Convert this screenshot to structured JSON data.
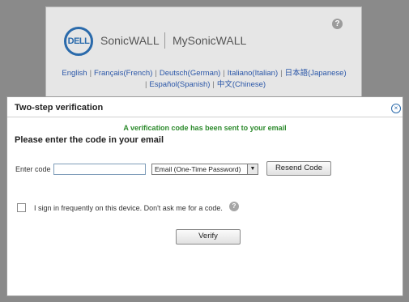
{
  "background": {
    "logo_text": "DELL",
    "brand_sonicwall": "SonicWALL",
    "brand_mysonicwall": "MySonicWALL",
    "help_icon_text": "?",
    "languages": [
      "English",
      "Français(French)",
      "Deutsch(German)",
      "Italiano(Italian)",
      "日本語(Japanese)",
      "Español(Spanish)",
      "中文(Chinese)"
    ],
    "separator": "|"
  },
  "modal": {
    "title": "Two-step verification",
    "close_glyph": "×",
    "status_message": "A verification code has been sent to your email",
    "heading": "Please enter the code in your email",
    "code_label": "Enter code",
    "code_value": "",
    "method_selected": "Email (One-Time Password)",
    "method_arrow": "▼",
    "resend_label": "Resend Code",
    "remember_label": "I sign in frequently on this device. Don't ask me for a code.",
    "remember_checked": false,
    "help_icon_text": "?",
    "verify_label": "Verify"
  },
  "colors": {
    "accent": "#2a6aab",
    "success": "#2c8a2c",
    "overlay": "#8a8a8a"
  }
}
